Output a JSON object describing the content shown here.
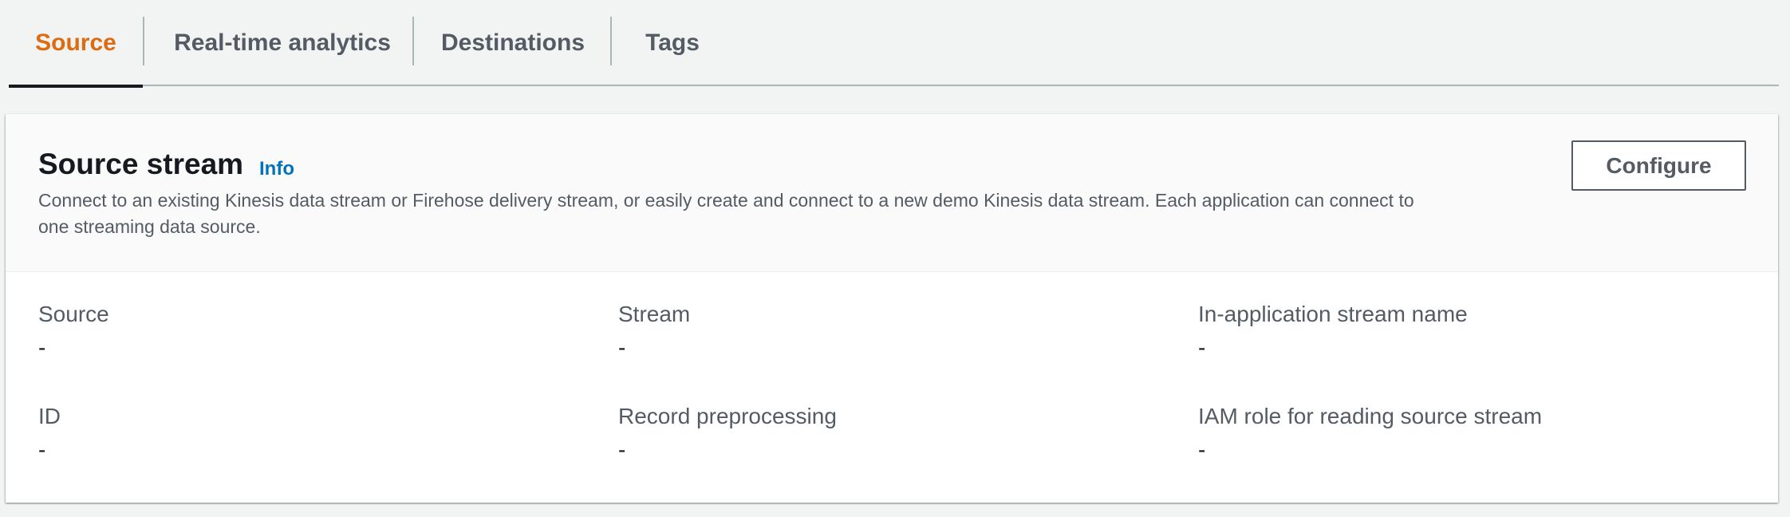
{
  "tabs": [
    {
      "label": "Source",
      "active": true
    },
    {
      "label": "Real-time analytics",
      "active": false
    },
    {
      "label": "Destinations",
      "active": false
    },
    {
      "label": "Tags",
      "active": false
    }
  ],
  "colors": {
    "active_tab": "#dd6b10",
    "link": "#0073bb",
    "text": "#16191f",
    "secondary_text": "#545b64",
    "page_background": "#f2f3f3"
  },
  "source_stream": {
    "title": "Source stream",
    "info_label": "Info",
    "description": "Connect to an existing Kinesis data stream or Firehose delivery stream, or easily create and connect to a new demo Kinesis data stream. Each application can connect to one streaming data source.",
    "configure_label": "Configure",
    "fields": [
      {
        "label": "Source",
        "value": "-"
      },
      {
        "label": "Stream",
        "value": "-"
      },
      {
        "label": "In-application stream name",
        "value": "-"
      },
      {
        "label": "ID",
        "value": "-"
      },
      {
        "label": "Record preprocessing",
        "value": "-"
      },
      {
        "label": "IAM role for reading source stream",
        "value": "-"
      }
    ]
  }
}
